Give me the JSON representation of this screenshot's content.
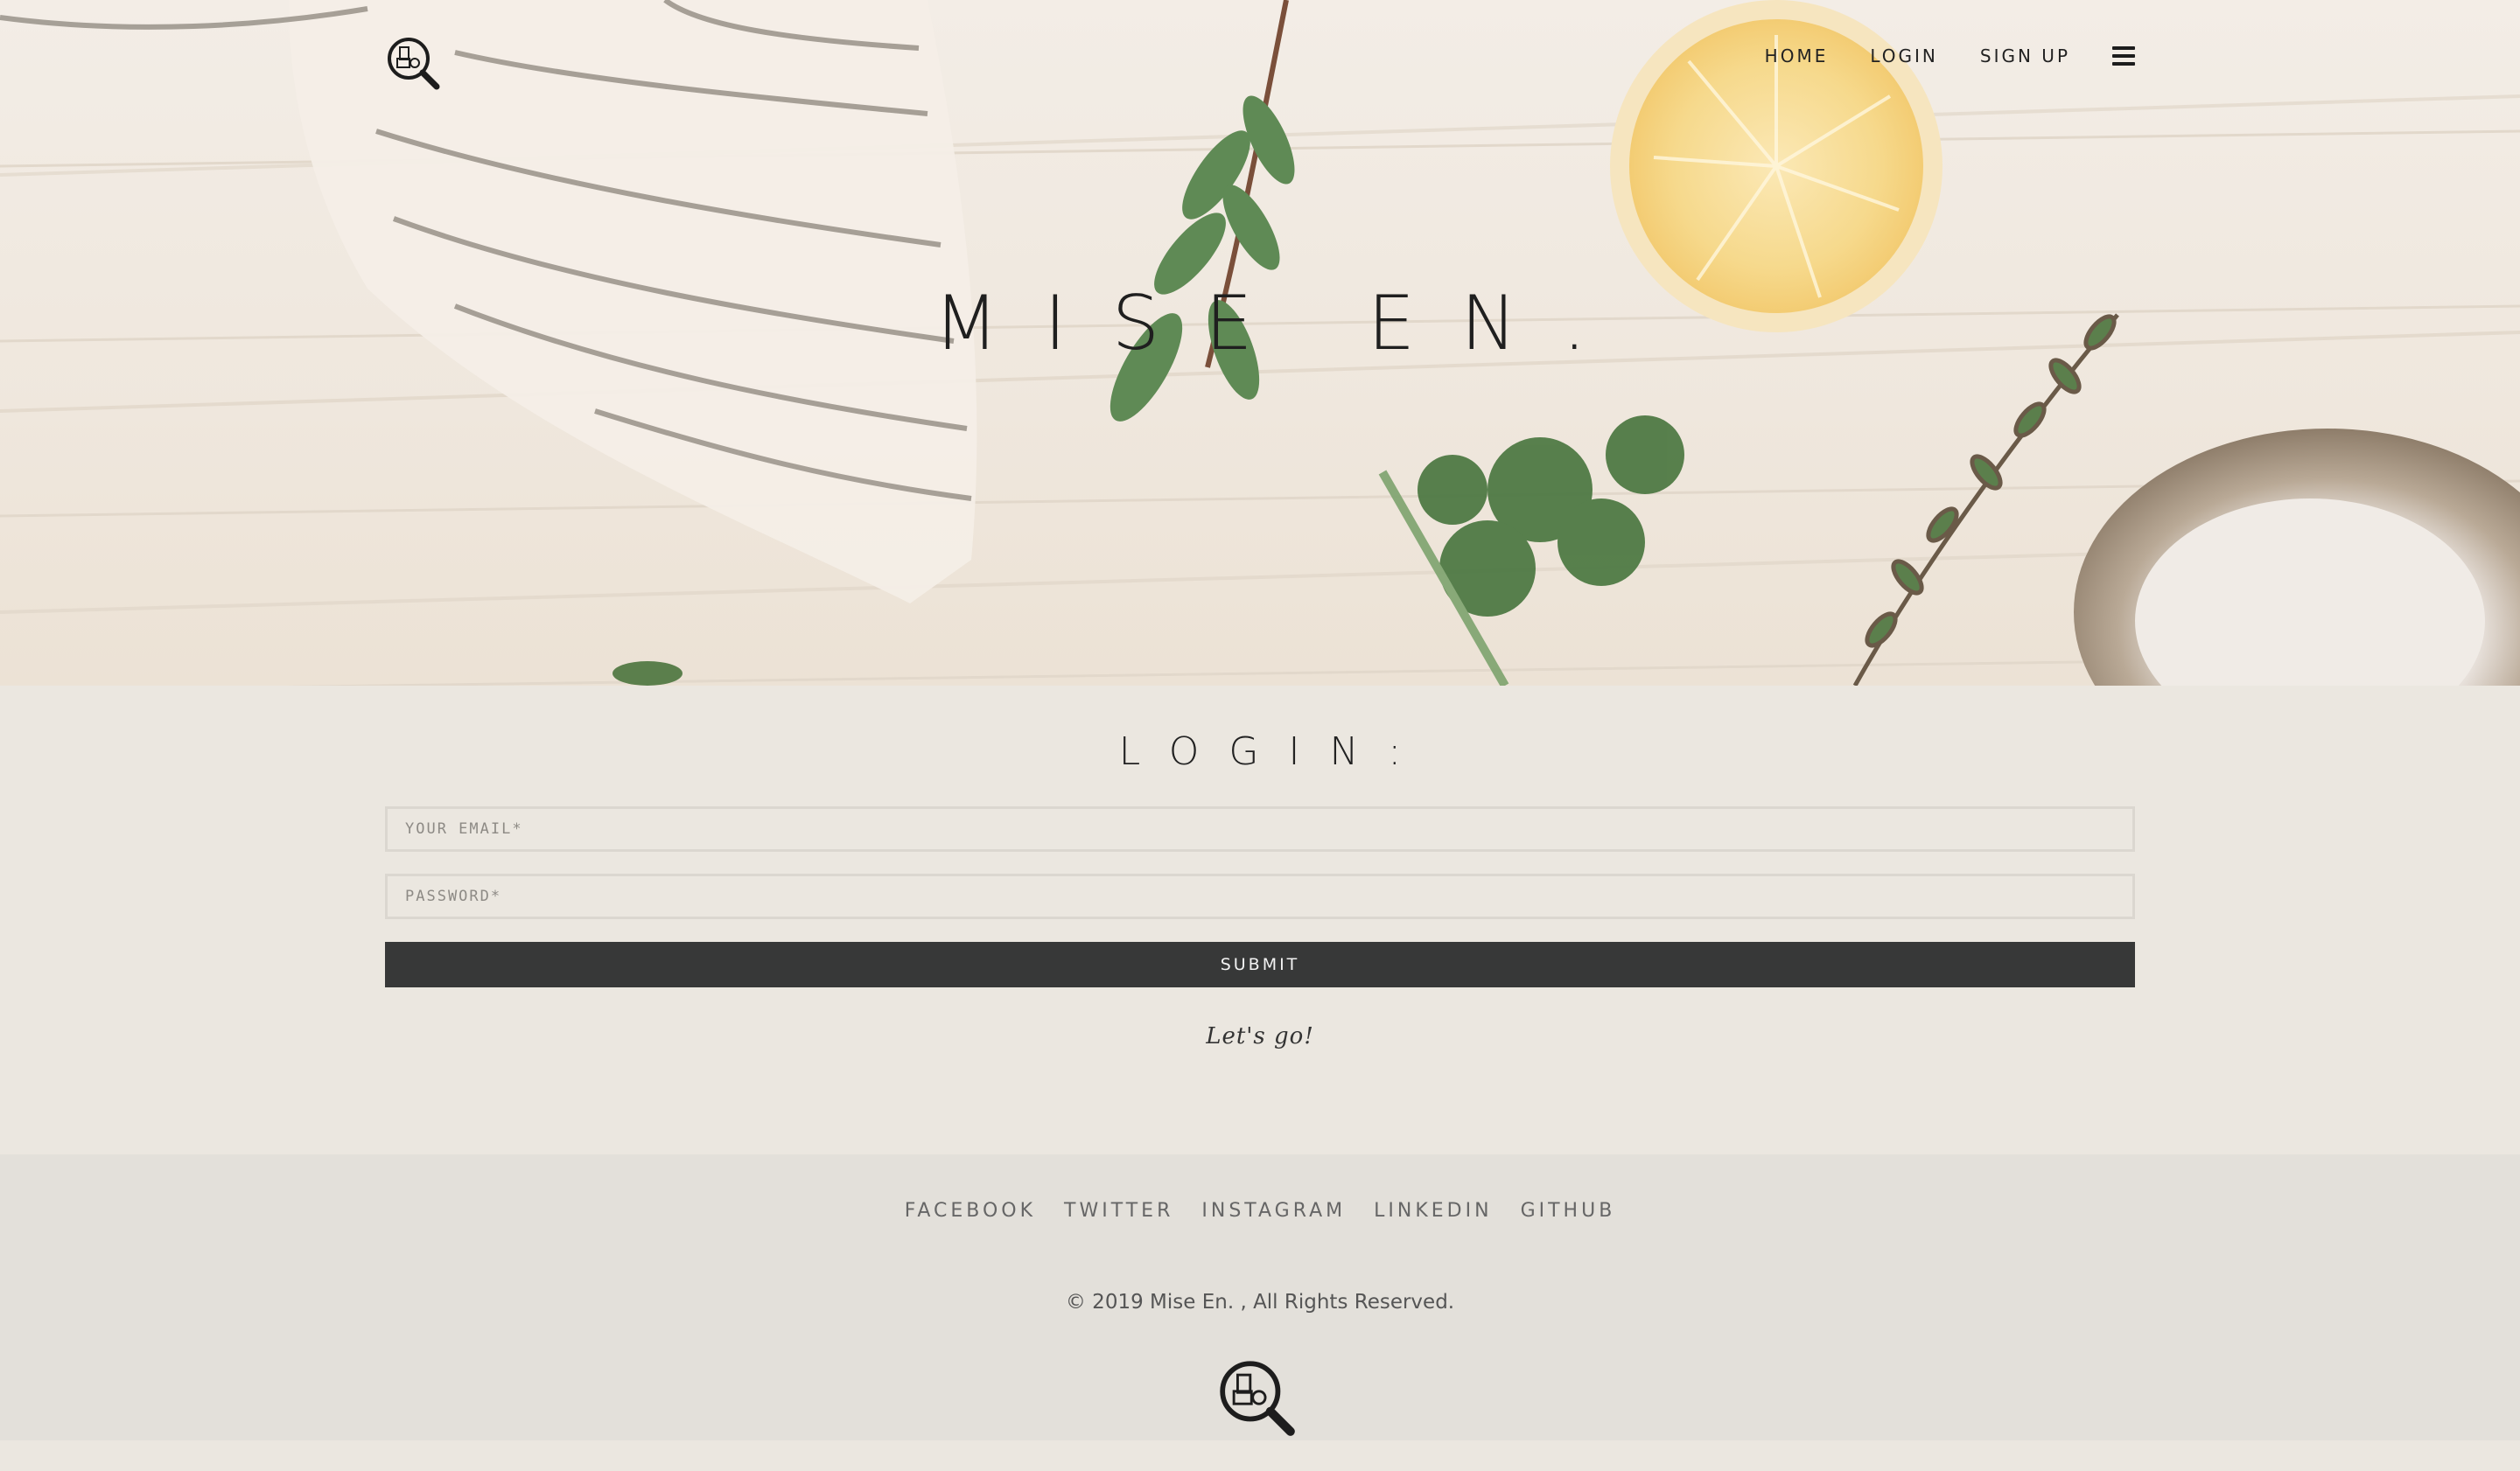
{
  "hero": {
    "title": "MISE EN.",
    "nav": {
      "home": "HOME",
      "login": "LOGIN",
      "signup": "SIGN UP"
    }
  },
  "login": {
    "title": "LOGIN:",
    "email_placeholder": "YOUR EMAIL*",
    "password_placeholder": "PASSWORD*",
    "submit_label": "SUBMIT",
    "tagline": "Let's go!"
  },
  "footer": {
    "social": [
      "FACEBOOK",
      "TWITTER",
      "INSTAGRAM",
      "LINKEDIN",
      "GITHUB"
    ],
    "copyright": "© 2019 Mise En. , All Rights Reserved."
  },
  "icons": {
    "logo": "magnifier-grocery-icon",
    "menu": "hamburger-menu-icon"
  },
  "colors": {
    "page_bg": "#ebe7e0",
    "footer_bg": "#e3e0da",
    "button_bg": "#373838",
    "text_dark": "#1f1f1f"
  }
}
